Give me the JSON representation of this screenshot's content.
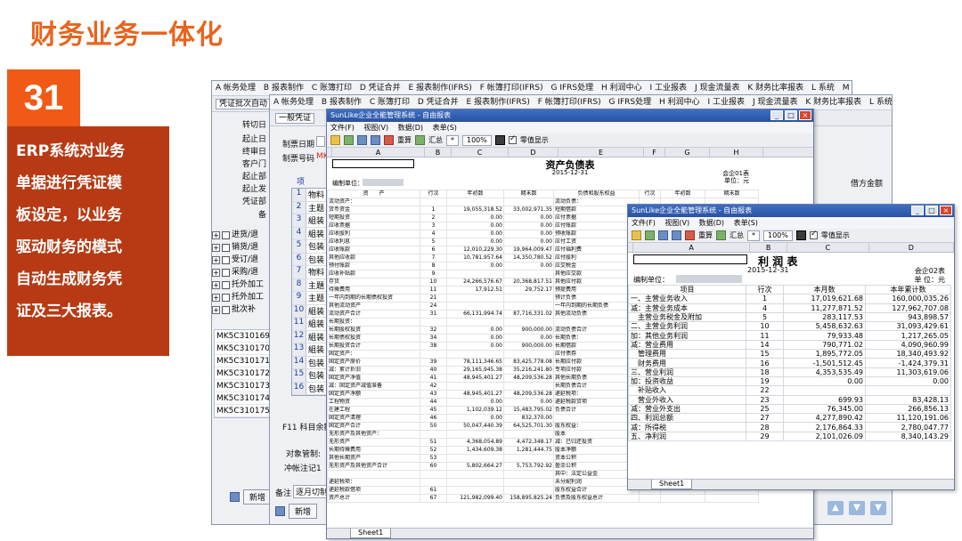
{
  "slide": {
    "title": "财务业务一体化",
    "number": "31",
    "description_lines": [
      "ERP系统对业务",
      "单据进行凭证模",
      "板设定，以业务",
      "驱动财务的模式",
      "自动生成财务凭",
      "证及三大报表。"
    ]
  },
  "menu": {
    "items": [
      "A 帐务处理",
      "B 报表制作",
      "C 账簿打印",
      "D 凭证合并",
      "E 报表制作(IFRS)",
      "F 帐簿打印(IFRS)",
      "G IFRS处理",
      "H 利润中心",
      "I 工业报表",
      "J 现金流量表",
      "K 财务比率报表",
      "L 系统",
      "M 帮助"
    ]
  },
  "win1": {
    "tab": "凭证批次自动",
    "labels": [
      "转切日",
      "起止日",
      "终审日",
      "客户门",
      "起止部",
      "起止发",
      "凭证部",
      "备"
    ],
    "tree": [
      "进货/退",
      "销货/退",
      "受订/退",
      "采购/退",
      "托外加工",
      "托外加工",
      "批次补"
    ],
    "codes": [
      "MK5C310169",
      "MK5C310170",
      "MK5C310171",
      "MK5C310172",
      "MK5C310173",
      "MK5C310174",
      "MK5C310175"
    ],
    "add_button": "新增"
  },
  "win2": {
    "tab": "一般凭证",
    "field_date": "制票日期",
    "field_no": "制票号码",
    "field_no_value": "MK",
    "grid_header": "项",
    "grid_rows": [
      {
        "n": "1",
        "t": "物料"
      },
      {
        "n": "2",
        "t": "主题"
      },
      {
        "n": "3",
        "t": "組装"
      },
      {
        "n": "4",
        "t": "組装"
      },
      {
        "n": "5",
        "t": "包装"
      },
      {
        "n": "6",
        "t": "包装"
      },
      {
        "n": "7",
        "t": "物料"
      },
      {
        "n": "8",
        "t": "主題"
      },
      {
        "n": "9",
        "t": "主题"
      },
      {
        "n": "10",
        "t": "組装"
      },
      {
        "n": "11",
        "t": "組装"
      },
      {
        "n": "12",
        "t": "組装"
      },
      {
        "n": "13",
        "t": "組装"
      },
      {
        "n": "14",
        "t": "包装"
      },
      {
        "n": "15",
        "t": "包装"
      },
      {
        "n": "16",
        "t": "包装"
      }
    ],
    "f11": "F11 科目余额",
    "object_mgmt": "对象管制:",
    "offset": "冲帐注记1",
    "remark": "备注",
    "remark_value": "逐月切制",
    "add_button": "新增",
    "right_col": "借方金额"
  },
  "balance_sheet": {
    "window_title": "SunLike企业全能管理系统 - 自由报表",
    "menu": [
      "文件(F)",
      "视图(V)",
      "数据(D)",
      "表单(S)"
    ],
    "toolbar": {
      "recalc": "重算",
      "summary": "汇总",
      "zoom": "100%",
      "zero_display": "零值显示"
    },
    "columns": [
      "A",
      "B",
      "C",
      "D",
      "E",
      "F",
      "G",
      "H"
    ],
    "title": "资产负债表",
    "date": "2015-12-31",
    "form_no": "会企01表",
    "unit": "单位：元",
    "org_label": "编制单位：",
    "header": [
      "资　　产",
      "行次",
      "年初数",
      "期末数",
      "负债和股东权益",
      "行次",
      "年初数",
      "期末数"
    ],
    "rows": [
      [
        "流动资产：",
        "",
        "",
        "",
        "流动负债：",
        "",
        "",
        ""
      ],
      [
        "货币资金",
        "1",
        "19,055,318.52",
        "33,002,971.35",
        "短期借款",
        "",
        "",
        ""
      ],
      [
        "短期投资",
        "2",
        "0.00",
        "0.00",
        "应付票据",
        "",
        "",
        ""
      ],
      [
        "应收票据",
        "3",
        "0.00",
        "0.00",
        "应付账款",
        "",
        "",
        ""
      ],
      [
        "应收股利",
        "4",
        "0.00",
        "0.00",
        "预收账款",
        "",
        "",
        ""
      ],
      [
        "应收利息",
        "5",
        "0.00",
        "0.00",
        "应付工资",
        "",
        "",
        ""
      ],
      [
        "应收账款",
        "6",
        "12,010,229.30",
        "19,964,009.47",
        "应付福利费",
        "",
        "",
        ""
      ],
      [
        "其他应收款",
        "7",
        "10,781,957.64",
        "14,350,780.52",
        "应付股利",
        "",
        "",
        ""
      ],
      [
        "预付账款",
        "8",
        "0.00",
        "0.00",
        "应交税金",
        "",
        "",
        ""
      ],
      [
        "应收补贴款",
        "9",
        "",
        "",
        "其他应交款",
        "",
        "",
        ""
      ],
      [
        "存货",
        "10",
        "24,266,576.67",
        "20,368,817.51",
        "其他应付款",
        "",
        "",
        ""
      ],
      [
        "待摊费用",
        "11",
        "17,912.51",
        "29,752.17",
        "预提费用",
        "",
        "",
        ""
      ],
      [
        "一年内到期的长期债权投资",
        "21",
        "",
        "",
        "预计负债",
        "",
        "",
        ""
      ],
      [
        "其他流动资产",
        "24",
        "",
        "",
        "一年内到期的长期负债",
        "",
        "",
        ""
      ],
      [
        "流动资产合计",
        "31",
        "66,131,994.74",
        "87,716,331.02",
        "其他流动负债",
        "",
        "",
        ""
      ],
      [
        "长期投资：",
        "",
        "",
        "",
        "",
        "",
        "",
        ""
      ],
      [
        "长期股权投资",
        "32",
        "0.00",
        "900,000.00",
        "流动负债合计",
        "",
        "",
        ""
      ],
      [
        "长期债权投资",
        "34",
        "0.00",
        "0.00",
        "长期负债：",
        "",
        "",
        ""
      ],
      [
        "长期投资合计",
        "38",
        "0.00",
        "900,000.00",
        "长期借款",
        "",
        "",
        ""
      ],
      [
        "固定资产：",
        "",
        "",
        "",
        "应付债券",
        "",
        "",
        ""
      ],
      [
        "固定资产原价",
        "39",
        "78,111,346.65",
        "83,425,778.08",
        "长期应付款",
        "",
        "",
        ""
      ],
      [
        "减：累计折旧",
        "40",
        "29,165,945.38",
        "35,216,241.80",
        "专项应付款",
        "",
        "",
        ""
      ],
      [
        "固定资产净值",
        "41",
        "48,945,401.27",
        "48,209,536.28",
        "其他长期负债",
        "",
        "",
        ""
      ],
      [
        "减：固定资产减值准备",
        "42",
        "",
        "",
        "长期负债合计",
        "",
        "",
        ""
      ],
      [
        "固定资产净额",
        "43",
        "48,945,401.27",
        "48,209,536.28",
        "递延税项：",
        "",
        "",
        ""
      ],
      [
        "工程物资",
        "44",
        "0.00",
        "0.00",
        "递延税款贷项",
        "",
        "",
        ""
      ],
      [
        "在建工程",
        "45",
        "1,102,039.12",
        "15,483,795.02",
        "负债合计",
        "",
        "",
        ""
      ],
      [
        "固定资产清理",
        "46",
        "0.00",
        "832,370.00",
        "",
        "",
        "",
        ""
      ],
      [
        "固定资产合计",
        "50",
        "50,047,440.39",
        "64,525,701.30",
        "股东权益：",
        "",
        "",
        ""
      ],
      [
        "无形资产及其他资产：",
        "",
        "",
        "",
        "股本",
        "",
        "",
        ""
      ],
      [
        "无形资产",
        "51",
        "4,368,054.89",
        "4,472,348.17",
        "减：已归还投资",
        "",
        "",
        ""
      ],
      [
        "长期待摊费用",
        "52",
        "1,434,609.38",
        "1,281,444.75",
        "股本净额",
        "",
        "",
        ""
      ],
      [
        "其他长期资产",
        "53",
        "",
        "",
        "资本公积",
        "",
        "",
        ""
      ],
      [
        "无形资产及其他资产合计",
        "60",
        "5,802,664.27",
        "5,753,792.92",
        "盈余公积",
        "",
        "",
        ""
      ],
      [
        "",
        "",
        "",
        "",
        "其中：法定公益金",
        "",
        "",
        ""
      ],
      [
        "递延税项：",
        "",
        "",
        "",
        "未分配利润",
        "",
        "",
        ""
      ],
      [
        "递延税款借项",
        "61",
        "",
        "",
        "股东权益合计",
        "",
        "",
        ""
      ],
      [
        "资产总计",
        "67",
        "121,982,099.40",
        "158,895,825.24",
        "负债及股东权益总计",
        "",
        "",
        ""
      ]
    ],
    "sheet_tab": "Sheet1"
  },
  "income_statement": {
    "window_title": "SunLike企业全能管理系统 - 自由报表",
    "menu": [
      "文件(F)",
      "视图(V)",
      "数据(D)",
      "表单(S)"
    ],
    "toolbar": {
      "recalc": "重算",
      "summary": "汇总",
      "zoom": "100%",
      "zero_display": "零值显示"
    },
    "columns": [
      "A",
      "B",
      "C",
      "D"
    ],
    "title": "利 润 表",
    "date": "2015-12-31",
    "form_no": "会企02表",
    "unit": "单 位：元",
    "org_label": "编制单位：",
    "header": [
      "项目",
      "行次",
      "本月数",
      "本年累计数"
    ],
    "rows": [
      [
        "一、主营业务收入",
        "1",
        "17,019,621.68",
        "160,000,035.26"
      ],
      [
        "减：主营业务成本",
        "4",
        "11,277,871.52",
        "127,962,707.08"
      ],
      [
        "　主营业务税金及附加",
        "5",
        "283,117.53",
        "943,898.57"
      ],
      [
        "二、主营业务利润",
        "10",
        "5,458,632.63",
        "31,093,429.61"
      ],
      [
        "加：其他业务利润",
        "11",
        "79,933.48",
        "1,217,265.05"
      ],
      [
        "减：营业费用",
        "14",
        "790,771.02",
        "4,090,960.99"
      ],
      [
        "　管理费用",
        "15",
        "1,895,772.05",
        "18,340,493.92"
      ],
      [
        "　财务费用",
        "16",
        "-1,501,512.45",
        "-1,424,379.31"
      ],
      [
        "三、营业利润",
        "18",
        "4,353,535.49",
        "11,303,619.06"
      ],
      [
        "加：投资收益",
        "19",
        "0.00",
        "0.00"
      ],
      [
        "　补贴收入",
        "22",
        "",
        ""
      ],
      [
        "　营业外收入",
        "23",
        "699.93",
        "83,428.13"
      ],
      [
        "减：营业外支出",
        "25",
        "76,345.00",
        "266,856.13"
      ],
      [
        "四、利润总额",
        "27",
        "4,277,890.42",
        "11,120,191.06"
      ],
      [
        "减：所得税",
        "28",
        "2,176,864.33",
        "2,780,047.77"
      ],
      [
        "五、净利润",
        "29",
        "2,101,026.09",
        "8,340,143.29"
      ]
    ],
    "sheet_tab": "Sheet1"
  }
}
